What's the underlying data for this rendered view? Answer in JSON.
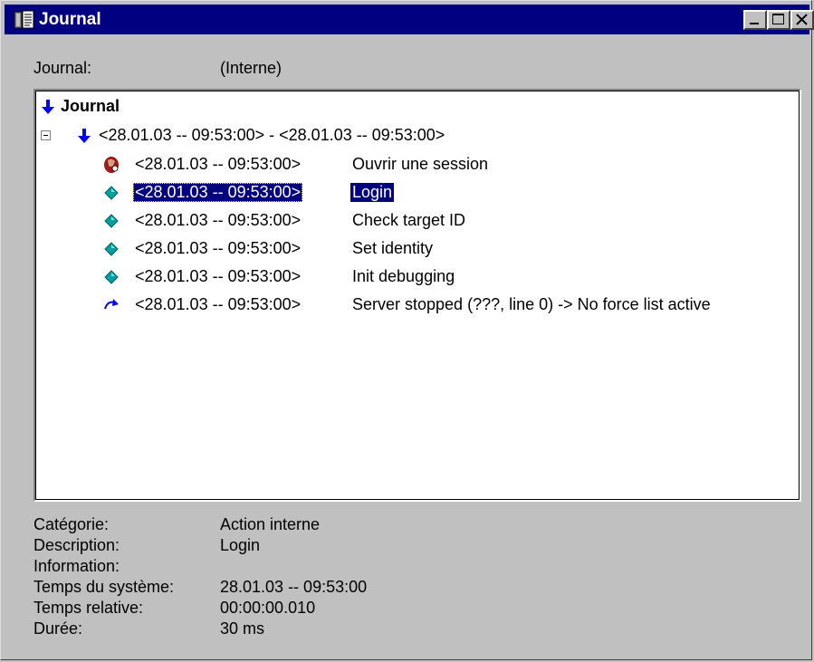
{
  "window": {
    "title": "Journal"
  },
  "journal_field": {
    "label": "Journal:",
    "value": "(Interne)"
  },
  "tree": {
    "root_label": "Journal",
    "session_label": "<28.01.03 -- 09:53:00> - <28.01.03 -- 09:53:00>",
    "entries": [
      {
        "icon": "open-session-icon",
        "timestamp": "<28.01.03 -- 09:53:00>",
        "description": "Ouvrir une session"
      },
      {
        "icon": "diamond-icon",
        "timestamp": "<28.01.03 -- 09:53:00>",
        "description": "Login",
        "selected": true
      },
      {
        "icon": "diamond-icon",
        "timestamp": "<28.01.03 -- 09:53:00>",
        "description": "Check target ID"
      },
      {
        "icon": "diamond-icon",
        "timestamp": "<28.01.03 -- 09:53:00>",
        "description": "Set identity"
      },
      {
        "icon": "diamond-icon",
        "timestamp": "<28.01.03 -- 09:53:00>",
        "description": "Init debugging"
      },
      {
        "icon": "curved-arrow-icon",
        "timestamp": "<28.01.03 -- 09:53:00>",
        "description": "Server stopped (???, line 0) -> No force list active"
      }
    ]
  },
  "details": {
    "categorie": {
      "label": "Catégorie:",
      "value": "Action interne"
    },
    "description": {
      "label": "Description:",
      "value": "Login"
    },
    "information": {
      "label": "Information:",
      "value": ""
    },
    "temps_systeme": {
      "label": "Temps du système:",
      "value": "28.01.03 -- 09:53:00"
    },
    "temps_relative": {
      "label": "Temps relative:",
      "value": "00:00:00.010"
    },
    "duree": {
      "label": "Durée:",
      "value": "30 ms"
    }
  },
  "colors": {
    "titlebar": "#000080",
    "selection": "#000080",
    "diamond": "#00a0a0",
    "arrow": "#0000ff"
  }
}
